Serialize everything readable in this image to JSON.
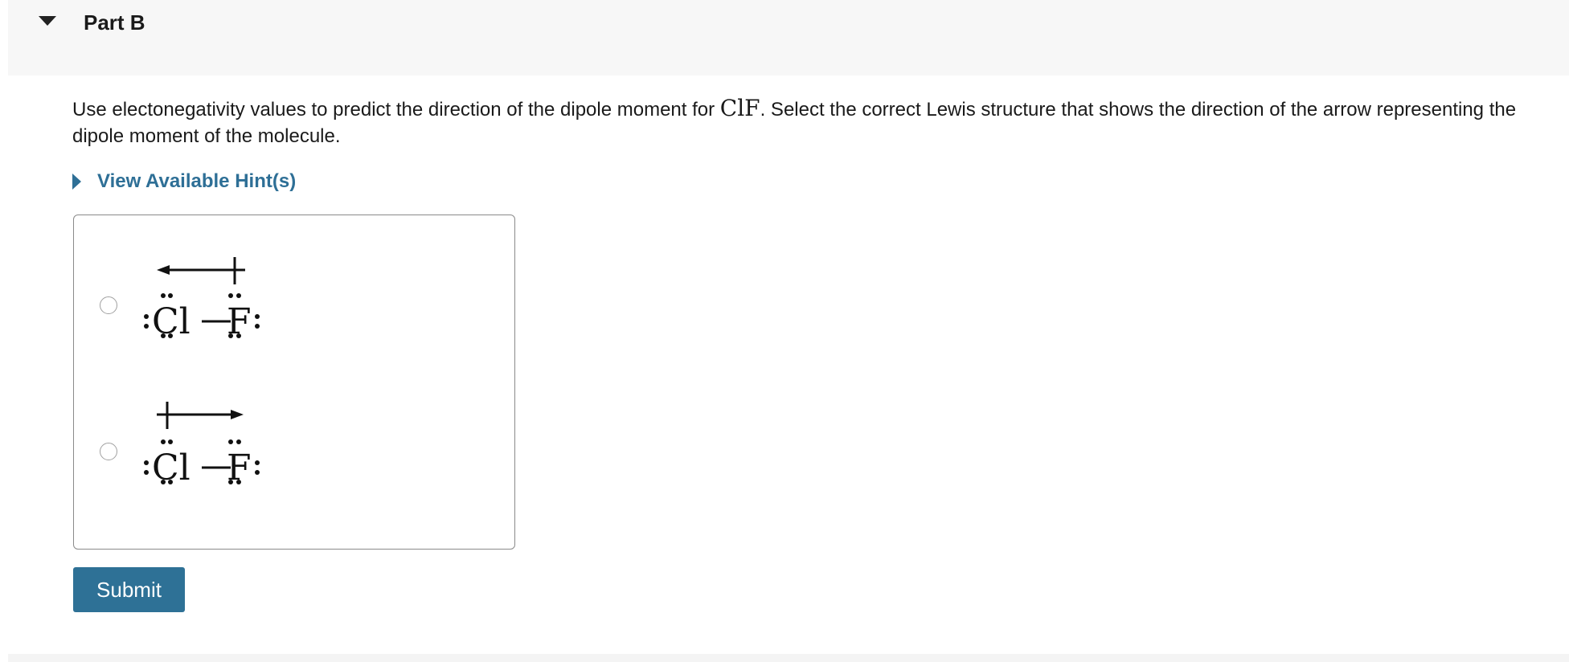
{
  "part": {
    "title": "Part B"
  },
  "question": {
    "text_before": "Use electonegativity values to predict the direction of the dipole moment for ",
    "formula": "ClF",
    "text_after": ". Select the correct Lewis structure that shows the direction of the arrow representing the dipole moment of the molecule."
  },
  "hint": {
    "label": "View Available Hint(s)"
  },
  "choices": [
    {
      "left_atom": "Cl",
      "right_atom": "F",
      "arrow_direction": "toward Cl",
      "selected": false
    },
    {
      "left_atom": "Cl",
      "right_atom": "F",
      "arrow_direction": "toward F",
      "selected": false
    }
  ],
  "submit": {
    "label": "Submit"
  }
}
